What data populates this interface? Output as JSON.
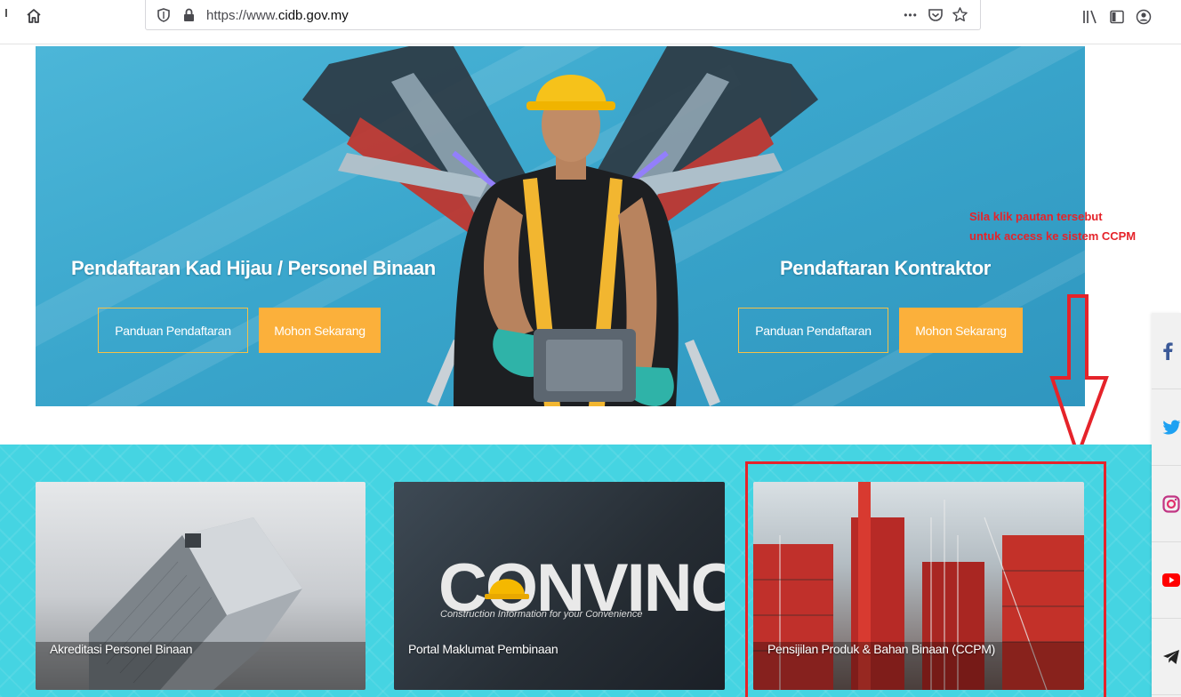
{
  "browser": {
    "url_prefix": "https://www.",
    "url_host": "cidb.gov.my",
    "icons": [
      "home-icon",
      "tracking-shield-icon",
      "padlock-icon",
      "more-dots-icon",
      "pocket-icon",
      "bookmark-star-icon",
      "library-icon",
      "sidebar-icon",
      "account-icon"
    ],
    "more_label": "•••"
  },
  "hero": {
    "left": {
      "title": "Pendaftaran Kad Hijau / Personel Binaan",
      "guide_label": "Panduan Pendaftaran",
      "apply_label": "Mohon Sekarang"
    },
    "right": {
      "title": "Pendaftaran Kontraktor",
      "guide_label": "Panduan Pendaftaran",
      "apply_label": "Mohon Sekarang"
    }
  },
  "annotation": {
    "line1": "Sila klik pautan tersebut",
    "line2": "untuk access ke sistem CCPM",
    "color": "#e5232a"
  },
  "cards": [
    {
      "label": "Akreditasi Personel Binaan"
    },
    {
      "label": "Portal Maklumat Pembinaan",
      "logo_text": "CONVINCE",
      "logo_tagline": "Construction Information for your Convenience"
    },
    {
      "label": "Pensijilan Produk & Bahan Binaan (CCPM)"
    }
  ],
  "social": {
    "items": [
      "facebook-icon",
      "twitter-icon",
      "instagram-icon",
      "youtube-icon",
      "telegram-icon"
    ]
  },
  "colors": {
    "accent_orange": "#fbb03b",
    "band_cyan": "#45d4e2",
    "hero_blue": "#3aa6cc",
    "annotation_red": "#e5232a"
  }
}
